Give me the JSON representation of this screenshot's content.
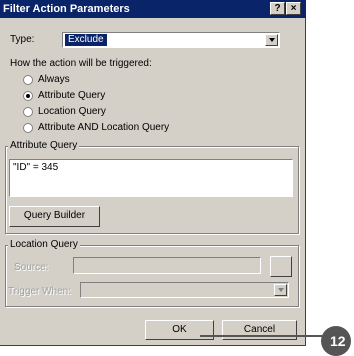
{
  "window": {
    "title": "Filter Action Parameters",
    "help_label": "?",
    "close_label": "×"
  },
  "type_row": {
    "label": "Type:",
    "value": "Exclude"
  },
  "trigger": {
    "prompt": "How the action will be triggered:",
    "options": [
      {
        "label": "Always",
        "selected": false
      },
      {
        "label": "Attribute Query",
        "selected": true
      },
      {
        "label": "Location Query",
        "selected": false
      },
      {
        "label": "Attribute AND Location Query",
        "selected": false
      }
    ]
  },
  "attribute_query": {
    "legend": "Attribute Query",
    "expression": "\"ID\" = 345",
    "builder_button": "Query Builder"
  },
  "location_query": {
    "legend": "Location Query",
    "source_label": "Source:",
    "trigger_when_label": "Trigger When:"
  },
  "buttons": {
    "ok": "OK",
    "cancel": "Cancel"
  },
  "callout": {
    "number": "12"
  }
}
